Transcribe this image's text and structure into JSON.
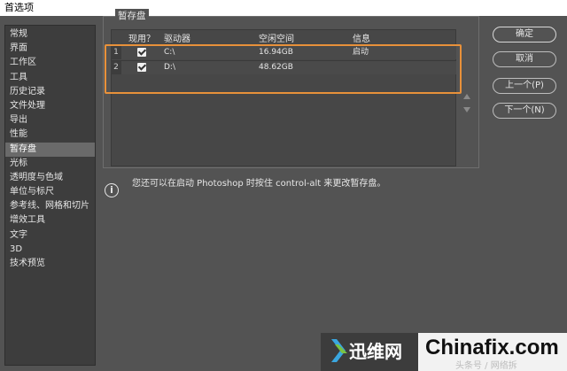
{
  "window": {
    "title": "首选项"
  },
  "sidebar": {
    "items": [
      {
        "label": "常规"
      },
      {
        "label": "界面"
      },
      {
        "label": "工作区"
      },
      {
        "label": "工具"
      },
      {
        "label": "历史记录"
      },
      {
        "label": "文件处理"
      },
      {
        "label": "导出"
      },
      {
        "label": "性能"
      },
      {
        "label": "暂存盘",
        "active": true
      },
      {
        "label": "光标"
      },
      {
        "label": "透明度与色域"
      },
      {
        "label": "单位与标尺"
      },
      {
        "label": "参考线、网格和切片"
      },
      {
        "label": "增效工具"
      },
      {
        "label": "文字"
      },
      {
        "label": "3D"
      },
      {
        "label": "技术预览"
      }
    ]
  },
  "scratch": {
    "group_title": "暂存盘",
    "headers": {
      "active": "现用？",
      "drive": "驱动器",
      "free": "空闲空间",
      "info": "信息"
    },
    "rows": [
      {
        "num": "1",
        "checked": true,
        "drive": "C:\\",
        "free": "16.94GB",
        "info": "启动"
      },
      {
        "num": "2",
        "checked": true,
        "drive": "D:\\",
        "free": "48.62GB",
        "info": ""
      }
    ]
  },
  "info": {
    "icon": "info-icon",
    "glyph": "i",
    "text": "您还可以在启动 Photoshop 时按住 control-alt 来更改暂存盘。"
  },
  "buttons": {
    "ok": "确定",
    "cancel": "取消",
    "prev": "上一个(P)",
    "next": "下一个(N)"
  },
  "watermark": {
    "brand_cn": "迅维网",
    "brand_en": "Chinafix.com",
    "caption": "头条号 / 网络拆"
  },
  "colors": {
    "highlight": "#e8913a",
    "background": "#535353",
    "active_item": "#6a6a6a"
  }
}
